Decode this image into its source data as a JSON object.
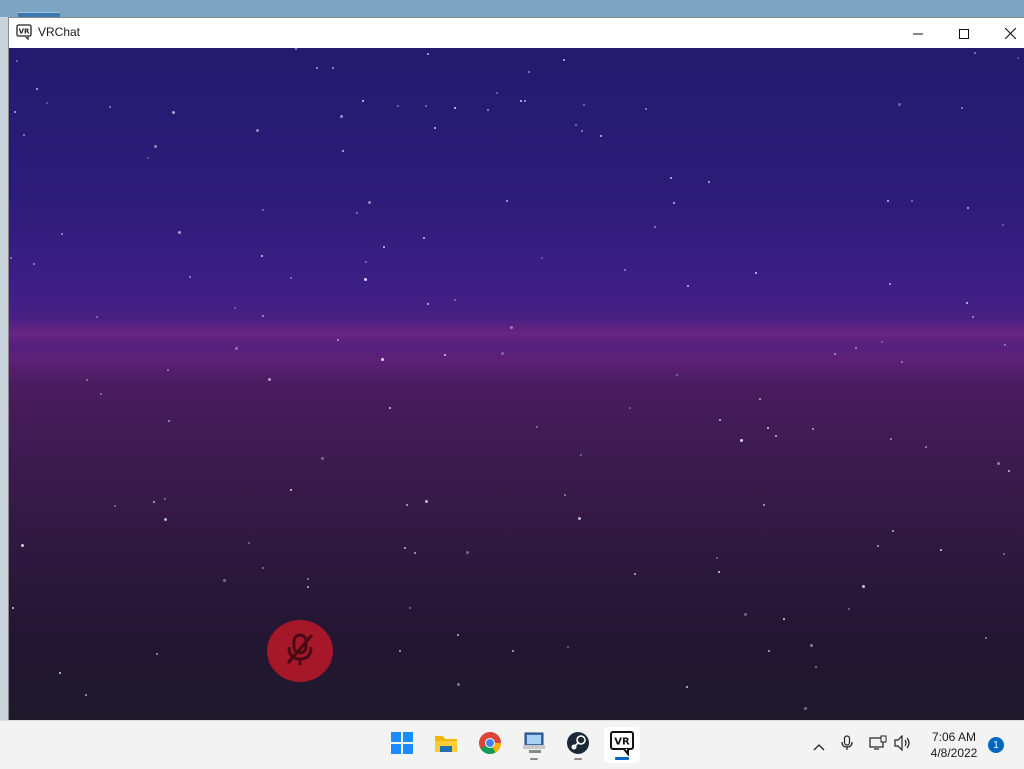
{
  "window": {
    "title": "VRChat",
    "app_icon": "vrchat-icon",
    "controls": [
      "minimize-icon",
      "maximize-icon",
      "close-icon"
    ]
  },
  "viewport": {
    "scene": "starfield-sky",
    "mute_indicator": "microphone-muted-icon",
    "colors": {
      "sky_top": "#251a6e",
      "horizon": "#5e2079",
      "ground": "#1e1a2c",
      "mute_badge": "#a7172a"
    }
  },
  "taskbar": {
    "apps": [
      {
        "name": "start-button",
        "icon": "windows-logo-icon",
        "active": false,
        "running": false
      },
      {
        "name": "file-explorer",
        "icon": "folder-icon",
        "active": false,
        "running": false
      },
      {
        "name": "chrome",
        "icon": "chrome-icon",
        "active": false,
        "running": false
      },
      {
        "name": "remote-desktop",
        "icon": "remote-desktop-icon",
        "active": false,
        "running": true
      },
      {
        "name": "steam",
        "icon": "steam-icon",
        "active": false,
        "running": true
      },
      {
        "name": "vrchat",
        "icon": "vrchat-icon",
        "active": true,
        "running": true
      }
    ],
    "tray": {
      "icons": [
        "chevron-up-icon",
        "microphone-icon",
        "network-icon",
        "speaker-icon"
      ],
      "time": "7:06 AM",
      "date": "4/8/2022",
      "notification_count": "1"
    },
    "colors": {
      "accent": "#0067c0",
      "background": "#f3f3f3"
    }
  }
}
